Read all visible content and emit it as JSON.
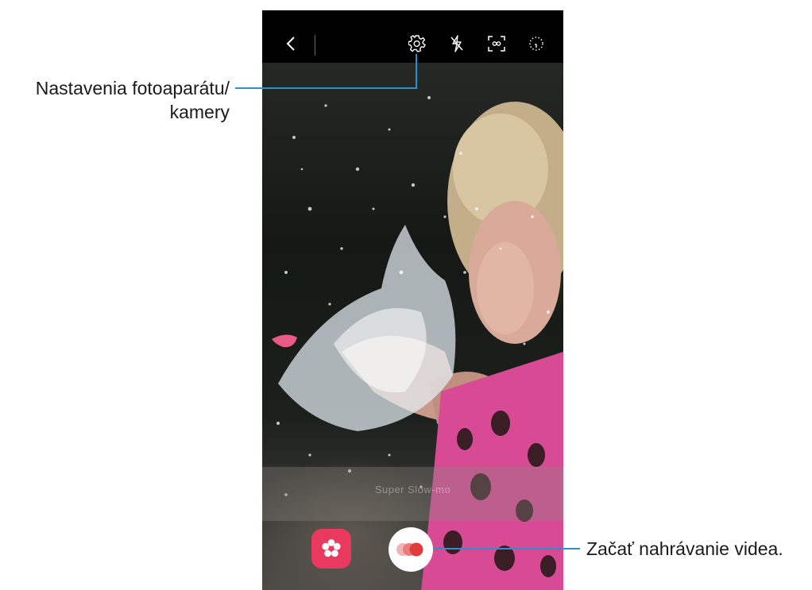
{
  "camera": {
    "top_bar": [
      {
        "icon": "chevron-left-icon"
      },
      {
        "icon": "gear-icon"
      },
      {
        "icon": "flash-off-icon"
      },
      {
        "icon": "focus-frame-icon"
      },
      {
        "icon": "timer-icon"
      }
    ],
    "overlay_text": "Super Slow-mo",
    "effect_icon": "flower-icon",
    "record_icon": "super-slow-mo-record-icon",
    "accent_color": "#e9395f",
    "record_color": "#e03a3a"
  },
  "annotations": {
    "settings_label": "Nastavenia fotoaparátu/ kamery",
    "record_label": "Začať nahrávanie videa.",
    "leader_color": "#2b8fd0"
  }
}
